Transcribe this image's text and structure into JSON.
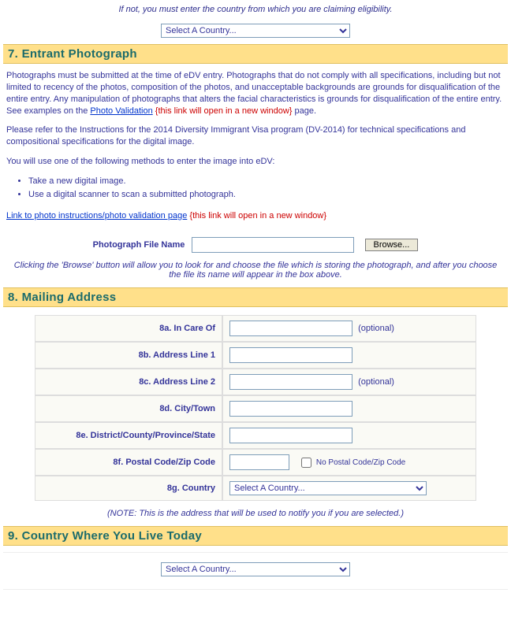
{
  "top_hint": "If not, you must enter the country from which you are claiming eligibility.",
  "country_select_placeholder": "Select A Country...",
  "section7": {
    "title": "7. Entrant Photograph",
    "para1_a": "Photographs must be submitted at the time of eDV entry. Photographs that do not comply with all specifications, including but not limited to recency of the photos, composition of the photos, and unacceptable backgrounds are grounds for disqualification of the entire entry. Any manipulation of photographs that alters the facial characteristics is grounds for disqualification of the entire entry. See examples on the ",
    "photo_validation_link": "Photo Validation",
    "new_window_note": "{this link will open in a new window}",
    "para1_b": " page.",
    "para2": "Please refer to the Instructions for the 2014 Diversity Immigrant Visa program (DV-2014) for technical specifications and compositional specifications for the digital image.",
    "para3": "You will use one of the following methods to enter the image into eDV:",
    "methods": [
      "Take a new digital image.",
      "Use a digital scanner to scan a submitted photograph."
    ],
    "link2": "Link to photo instructions/photo validation page",
    "file_label": "Photograph File Name",
    "browse": "Browse...",
    "browse_hint": "Clicking the 'Browse' button will allow you to look for and choose the file which is storing the photograph, and after you choose the file its name will appear in the box above."
  },
  "section8": {
    "title": "8. Mailing Address",
    "rows": {
      "a": {
        "label": "8a. In Care Of",
        "optional": "(optional)"
      },
      "b": {
        "label": "8b. Address Line 1"
      },
      "c": {
        "label": "8c. Address Line 2",
        "optional": "(optional)"
      },
      "d": {
        "label": "8d. City/Town"
      },
      "e": {
        "label": "8e. District/County/Province/State"
      },
      "f": {
        "label": "8f. Postal Code/Zip Code",
        "no_postal": "No Postal Code/Zip Code"
      },
      "g": {
        "label": "8g. Country"
      }
    },
    "note": "(NOTE: This is the address that will be used to notify you if you are selected.)"
  },
  "section9": {
    "title": "9. Country Where You Live Today"
  }
}
